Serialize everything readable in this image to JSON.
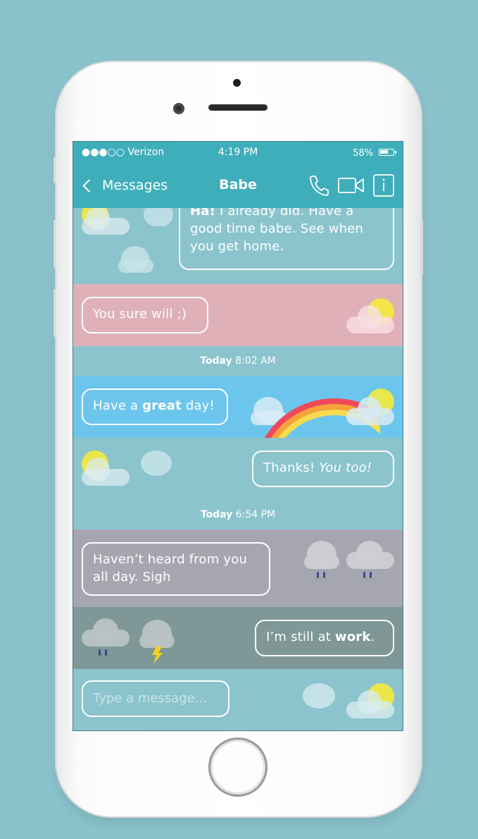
{
  "status_bar": {
    "carrier": "●●●○○ Verizon",
    "time": "4:19 PM",
    "battery": "58%"
  },
  "nav": {
    "back_label": "Messages",
    "title": "Babe"
  },
  "messages": [
    {
      "type": "sent",
      "bold_prefix": "Ha!",
      "text": " I already did. Have a good time babe. See when you get home.",
      "weather": "partly-cloudy"
    },
    {
      "type": "received",
      "text": "You sure will ;)",
      "weather": "pink-sunny"
    },
    {
      "type": "timestamp",
      "day": "Today",
      "time": " 8:02 AM"
    },
    {
      "type": "received",
      "before": "Have a ",
      "bold": "great",
      "after": " day!",
      "weather": "rainbow"
    },
    {
      "type": "sent",
      "plain": "Thanks! ",
      "italic": "You too!",
      "weather": "partly-cloudy"
    },
    {
      "type": "timestamp",
      "day": "Today",
      "time": " 6:54 PM"
    },
    {
      "type": "received",
      "text": "Haven’t heard from you all day. Sigh",
      "weather": "rain"
    },
    {
      "type": "sent",
      "before": "I’m still at ",
      "bold": "work",
      "after": ".",
      "weather": "storm"
    }
  ],
  "composer": {
    "placeholder": "Type a message..."
  },
  "colors": {
    "header": "#3faebb",
    "sky_blue": "#8bc4cd",
    "pink": "#dfb0b8",
    "bright_blue": "#6cc5ec",
    "rain_gray": "#a6a6b0",
    "storm_gray": "#7f9797"
  },
  "icons": [
    "chevron-left-icon",
    "phone-icon",
    "video-camera-icon",
    "info-icon",
    "cloud-icon",
    "sun-icon",
    "rainbow-icon",
    "rain-drop-icon",
    "lightning-icon"
  ]
}
